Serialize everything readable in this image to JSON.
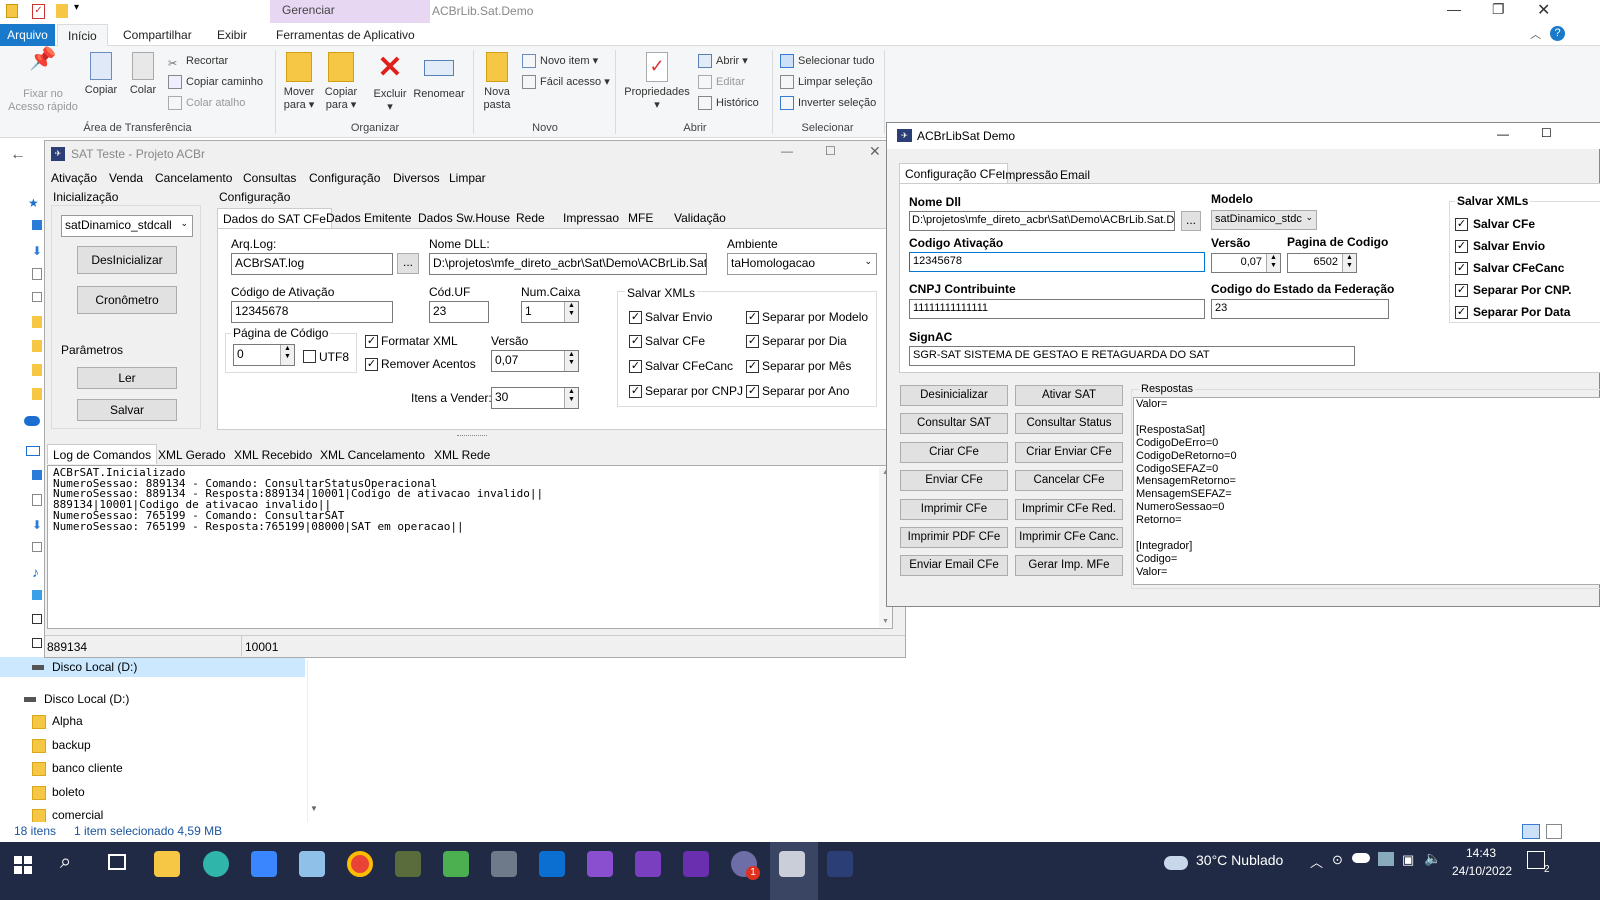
{
  "explorer": {
    "title": "ACBrLib.Sat.Demo",
    "context_group": "Gerenciar",
    "tabs": [
      "Arquivo",
      "Início",
      "Compartilhar",
      "Exibir",
      "Ferramentas de Aplicativo"
    ],
    "ribbon": {
      "pin": "Fixar no\nAcesso rápido",
      "copy": "Copiar",
      "paste": "Colar",
      "cut": "Recortar",
      "copy_path": "Copiar caminho",
      "paste_shortcut": "Colar atalho",
      "clipboard_group": "Área de Transferência",
      "move_to": "Mover\npara ▾",
      "copy_to": "Copiar\npara ▾",
      "delete": "Excluir\n▾",
      "rename": "Renomear",
      "organize_group": "Organizar",
      "new_folder": "Nova\npasta",
      "new_item": "Novo item ▾",
      "easy_access": "Fácil acesso ▾",
      "new_group": "Novo",
      "properties": "Propriedades\n▾",
      "open": "Abrir ▾",
      "edit": "Editar",
      "history": "Histórico",
      "open_group": "Abrir",
      "select_all": "Selecionar tudo",
      "clear_selection": "Limpar seleção",
      "invert_selection": "Inverter seleção",
      "select_group": "Selecionar"
    },
    "nav_selected": "Disco Local (D:)",
    "tree_drive": "Disco Local (D:)",
    "folders": [
      "Alpha",
      "backup",
      "banco cliente",
      "boleto",
      "comercial"
    ],
    "status_items": "18 itens",
    "status_selected": "1 item selecionado  4,59 MB"
  },
  "satwin": {
    "title": "SAT Teste - Projeto ACBr",
    "menu": [
      "Ativação",
      "Venda",
      "Cancelamento",
      "Consultas",
      "Configuração",
      "Diversos",
      "Limpar"
    ],
    "init_label": "Inicialização",
    "lib_select": "satDinamico_stdcall",
    "btn_deinit": "DesInicializar",
    "btn_timer": "Cronômetro",
    "params_label": "Parâmetros",
    "btn_read": "Ler",
    "btn_save": "Salvar",
    "config_label": "Configuração",
    "config_tabs": [
      "Dados do SAT CFe",
      "Dados Emitente",
      "Dados Sw.House",
      "Rede",
      "Impressao",
      "MFE",
      "Validação"
    ],
    "arqlog_label": "Arq.Log:",
    "arqlog_value": "ACBrSAT.log",
    "dll_label": "Nome DLL:",
    "dll_value": "D:\\projetos\\mfe_direto_acbr\\Sat\\Demo\\ACBrLib.Sat",
    "ambiente_label": "Ambiente",
    "ambiente_value": "taHomologacao",
    "codativ_label": "Código de Ativação",
    "codativ_value": "12345678",
    "coduf_label": "Cód.UF",
    "coduf_value": "23",
    "numcaixa_label": "Num.Caixa",
    "numcaixa_value": "1",
    "pagcod_label": "Página de Código",
    "pagcod_value": "0",
    "utf8_label": "UTF8",
    "format_xml": "Formatar XML",
    "remove_acc": "Remover Acentos",
    "versao_label": "Versão",
    "versao_value": "0,07",
    "itens_label": "Itens a Vender:",
    "itens_value": "30",
    "salvar_xmls": "Salvar XMLs",
    "chk_labels": [
      "Salvar Envio",
      "Salvar CFe",
      "Salvar CFeCanc",
      "Separar por CNPJ",
      "Separar por Modelo",
      "Separar por Dia",
      "Separar por Mês",
      "Separar por Ano"
    ],
    "log_tabs": [
      "Log de Comandos",
      "XML Gerado",
      "XML Recebido",
      "XML Cancelamento",
      "XML Rede"
    ],
    "log_text": "ACBrSAT.Inicializado\nNumeroSessao: 889134 - Comando: ConsultarStatusOperacional\nNumeroSessao: 889134 - Resposta:889134|10001|Codigo de ativacao invalido||\n889134|10001|Codigo de ativacao invalido||\nNumeroSessao: 765199 - Comando: ConsultarSAT\nNumeroSessao: 765199 - Resposta:765199|08000|SAT em operacao||",
    "status_1": "889134",
    "status_2": "10001"
  },
  "demowin": {
    "title": "ACBrLibSat Demo",
    "tabs": [
      "Configuração CFe",
      "Impressão",
      "Email"
    ],
    "nome_dll_label": "Nome Dll",
    "nome_dll_value": "D:\\projetos\\mfe_direto_acbr\\Sat\\Demo\\ACBrLib.Sat.Dc",
    "browse": "...",
    "modelo_label": "Modelo",
    "modelo_value": "satDinamico_stdc",
    "cod_ativ_label": "Codigo Ativação",
    "cod_ativ_value": "12345678",
    "versao_label": "Versão",
    "versao_value": "0,07",
    "pagina_label": "Pagina de Codigo",
    "pagina_value": "6502",
    "cnpj_label": "CNPJ Contribuinte",
    "cnpj_value": "11111111111111",
    "cod_estado_label": "Codigo do Estado da Federação",
    "cod_estado_value": "23",
    "signac_label": "SignAC",
    "signac_value": "SGR-SAT SISTEMA DE GESTAO E RETAGUARDA DO SAT",
    "salvar_xmls": "Salvar XMLs",
    "xml_checks": [
      "Salvar CFe",
      "Salvar Envio",
      "Salvar CFeCanc",
      "Separar Por CNP.",
      "Separar Por Data"
    ],
    "buttons_left": [
      "Desinicializar",
      "Consultar SAT",
      "Criar CFe",
      "Enviar CFe",
      "Imprimir CFe",
      "Imprimir PDF CFe",
      "Enviar Email CFe"
    ],
    "buttons_right": [
      "Ativar SAT",
      "Consultar Status",
      "Criar Enviar CFe",
      "Cancelar CFe",
      "Imprimir CFe Red.",
      "Imprimir CFe Canc.",
      "Gerar Imp. MFe"
    ],
    "respostas_label": "Respostas",
    "respostas_text": "Valor=\n\n[RespostaSat]\nCodigoDeErro=0\nCodigoDeRetorno=0\nCodigoSEFAZ=0\nMensagemRetorno=\nMensagemSEFAZ=\nNumeroSessao=0\nRetorno=\n\n[Integrador]\nCodigo=\nValor="
  },
  "taskbar": {
    "weather": "30°C  Nublado",
    "time": "14:43",
    "date": "24/10/2022",
    "notif_count": "2",
    "acbr_badge": "1"
  }
}
